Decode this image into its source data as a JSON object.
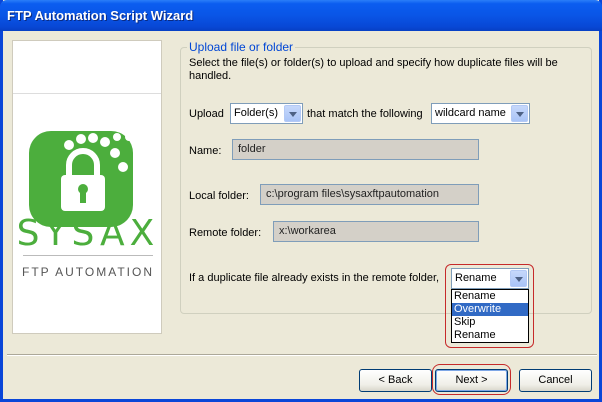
{
  "window": {
    "title": "FTP Automation Script Wizard"
  },
  "logo": {
    "name": "SYSAX",
    "tagline": "FTP AUTOMATION",
    "brand_color": "#4cae3d"
  },
  "group": {
    "title": "Upload file or folder",
    "description": "Select the file(s) or folder(s) to upload and specify how duplicate files will be handled."
  },
  "form": {
    "upload_label": "Upload",
    "upload_type": "Folder(s)",
    "match_text": "that match the following",
    "match_type": "wildcard name",
    "name_label": "Name:",
    "name_value": "folder",
    "local_label": "Local folder:",
    "local_value": "c:\\program files\\sysaxftpautomation",
    "remote_label": "Remote folder:",
    "remote_value": "x:\\workarea",
    "duplicate_label": "If a duplicate file already exists in the remote folder,",
    "duplicate_value": "Rename",
    "duplicate_options": [
      "Rename",
      "Overwrite",
      "Skip",
      "Rename"
    ],
    "duplicate_selected_index": 1
  },
  "buttons": {
    "back": "< Back",
    "next": "Next >",
    "cancel": "Cancel"
  },
  "colors": {
    "highlight": "#c62a2a",
    "selection": "#316ac5",
    "group_title": "#0046d5"
  }
}
